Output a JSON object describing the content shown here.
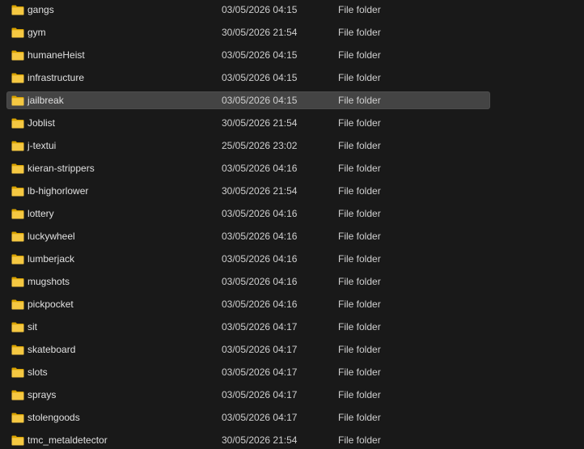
{
  "colors": {
    "background": "#191919",
    "selected_row": "#444444",
    "folder_icon_back": "#d9a300",
    "folder_icon_front": "#f5c842"
  },
  "files": [
    {
      "name": "gangs",
      "date": "03/05/2026 04:15",
      "type": "File folder",
      "icon": "folder-icon"
    },
    {
      "name": "gym",
      "date": "30/05/2026 21:54",
      "type": "File folder",
      "icon": "folder-icon"
    },
    {
      "name": "humaneHeist",
      "date": "03/05/2026 04:15",
      "type": "File folder",
      "icon": "folder-icon"
    },
    {
      "name": "infrastructure",
      "date": "03/05/2026 04:15",
      "type": "File folder",
      "icon": "folder-icon"
    },
    {
      "name": "jailbreak",
      "date": "03/05/2026 04:15",
      "type": "File folder",
      "icon": "folder-icon",
      "selected": true
    },
    {
      "name": "Joblist",
      "date": "30/05/2026 21:54",
      "type": "File folder",
      "icon": "folder-icon"
    },
    {
      "name": "j-textui",
      "date": "25/05/2026 23:02",
      "type": "File folder",
      "icon": "folder-icon"
    },
    {
      "name": "kieran-strippers",
      "date": "03/05/2026 04:16",
      "type": "File folder",
      "icon": "folder-icon"
    },
    {
      "name": "lb-highorlower",
      "date": "30/05/2026 21:54",
      "type": "File folder",
      "icon": "folder-icon"
    },
    {
      "name": "lottery",
      "date": "03/05/2026 04:16",
      "type": "File folder",
      "icon": "folder-icon"
    },
    {
      "name": "luckywheel",
      "date": "03/05/2026 04:16",
      "type": "File folder",
      "icon": "folder-icon"
    },
    {
      "name": "lumberjack",
      "date": "03/05/2026 04:16",
      "type": "File folder",
      "icon": "folder-icon"
    },
    {
      "name": "mugshots",
      "date": "03/05/2026 04:16",
      "type": "File folder",
      "icon": "folder-icon"
    },
    {
      "name": "pickpocket",
      "date": "03/05/2026 04:16",
      "type": "File folder",
      "icon": "folder-icon"
    },
    {
      "name": "sit",
      "date": "03/05/2026 04:17",
      "type": "File folder",
      "icon": "folder-icon"
    },
    {
      "name": "skateboard",
      "date": "03/05/2026 04:17",
      "type": "File folder",
      "icon": "folder-icon"
    },
    {
      "name": "slots",
      "date": "03/05/2026 04:17",
      "type": "File folder",
      "icon": "folder-icon"
    },
    {
      "name": "sprays",
      "date": "03/05/2026 04:17",
      "type": "File folder",
      "icon": "folder-icon"
    },
    {
      "name": "stolengoods",
      "date": "03/05/2026 04:17",
      "type": "File folder",
      "icon": "folder-icon"
    },
    {
      "name": "tmc_metaldetector",
      "date": "30/05/2026 21:54",
      "type": "File folder",
      "icon": "folder-icon"
    }
  ]
}
